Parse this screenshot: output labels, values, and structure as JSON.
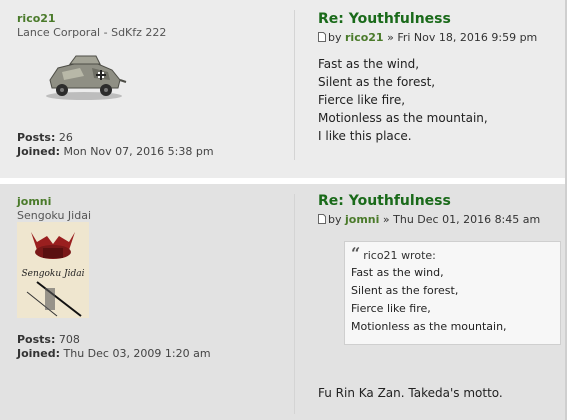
{
  "posts": [
    {
      "username": "rico21",
      "rank": "Lance Corporal - SdKfz 222",
      "avatar_icon": "armored-car-icon",
      "posts_label": "Posts:",
      "posts_value": "26",
      "joined_label": "Joined:",
      "joined_value": "Mon Nov 07, 2016 5:38 pm",
      "title": "Re: Youthfulness",
      "by": "by",
      "author": "rico21",
      "separator": "»",
      "date": "Fri Nov 18, 2016 9:59 pm",
      "lines": [
        "Fast as the wind,",
        "Silent as the forest,",
        "Fierce like fire,",
        "Motionless as the mountain,",
        "I like this place."
      ]
    },
    {
      "username": "jomni",
      "rank": "Sengoku Jidai",
      "avatar_icon": "samurai-helmet-icon",
      "avatar_text": "Sengoku Jidai",
      "posts_label": "Posts:",
      "posts_value": "708",
      "joined_label": "Joined:",
      "joined_value": "Thu Dec 03, 2009 1:20 am",
      "title": "Re: Youthfulness",
      "by": "by",
      "author": "jomni",
      "separator": "»",
      "date": "Thu Dec 01, 2016 8:45 am",
      "quote": {
        "author": "rico21",
        "wrote": "wrote:",
        "lines": [
          "Fast as the wind,",
          "Silent as the forest,",
          "Fierce like fire,",
          "Motionless as the mountain,"
        ]
      },
      "reply": "Fu Rin Ka Zan. Takeda's motto."
    }
  ]
}
